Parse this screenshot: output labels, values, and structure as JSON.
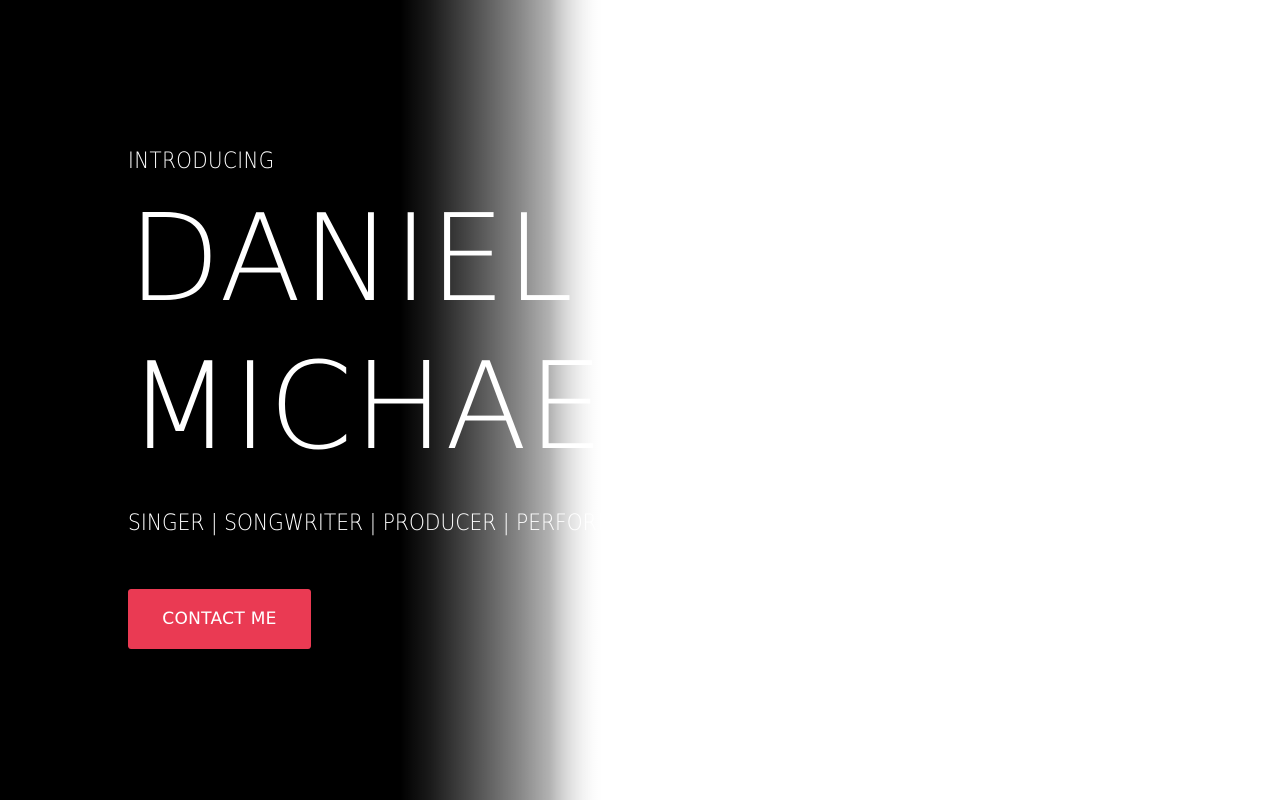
{
  "hero": {
    "intro": "INTRODUCING",
    "first_name": "DANIEL",
    "last_name": "MICHAEL",
    "roles": "SINGER | SONGWRITER | PRODUCER | PERFORMER",
    "cta_label": "CONTACT ME"
  },
  "colors": {
    "accent": "#ea3a53",
    "background_dark": "#000000",
    "background_light": "#ffffff",
    "text": "#ffffff"
  }
}
